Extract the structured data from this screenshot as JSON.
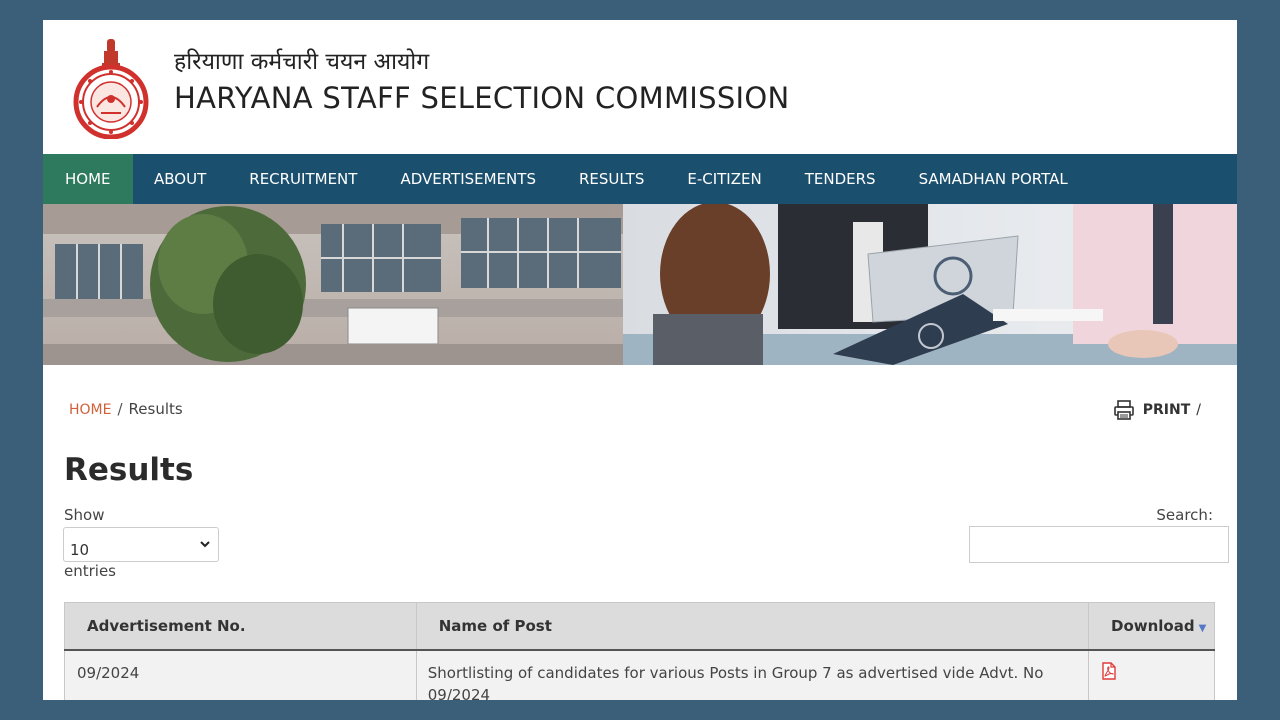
{
  "header": {
    "title_hindi": "हरियाणा कर्मचारी चयन आयोग",
    "title_english": "HARYANA STAFF SELECTION COMMISSION"
  },
  "nav": {
    "items": [
      {
        "label": "HOME",
        "active": true
      },
      {
        "label": "ABOUT"
      },
      {
        "label": "RECRUITMENT"
      },
      {
        "label": "ADVERTISEMENTS"
      },
      {
        "label": "RESULTS"
      },
      {
        "label": "E-CITIZEN"
      },
      {
        "label": "TENDERS"
      },
      {
        "label": "SAMADHAN PORTAL"
      }
    ]
  },
  "breadcrumb": {
    "home": "HOME",
    "separator": "/",
    "current": "Results"
  },
  "print": {
    "label": "PRINT",
    "slash": "/"
  },
  "page": {
    "title": "Results"
  },
  "length_control": {
    "show_label": "Show",
    "selected": "10",
    "entries_label": "entries"
  },
  "search": {
    "label": "Search:",
    "value": ""
  },
  "table": {
    "headers": [
      "Advertisement No.",
      "Name of Post",
      "Download"
    ],
    "sort_indicator": "▼",
    "rows": [
      {
        "adv_no": "09/2024",
        "post": "Shortlisting of candidates for various Posts in Group 7 as advertised vide Advt. No 09/2024",
        "download_icon": "pdf-icon"
      }
    ]
  },
  "colors": {
    "nav_bg": "#1b4f6e",
    "nav_active": "#2e7a5e",
    "page_bg": "#3b5f78",
    "breadcrumb_home": "#d0603a",
    "pdf_red": "#e03a3a"
  }
}
